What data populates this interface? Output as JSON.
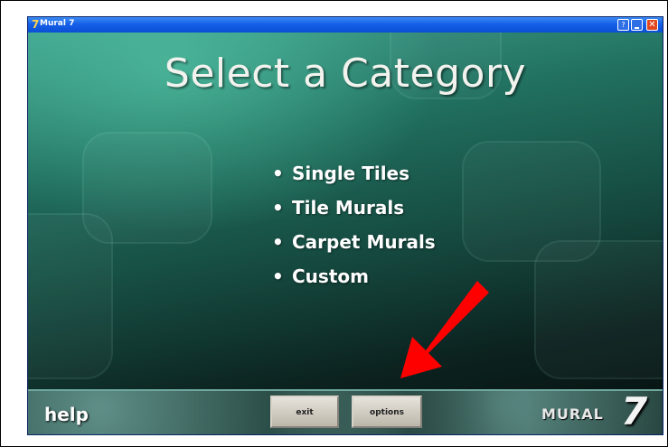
{
  "window": {
    "title": "Mural 7",
    "app_icon_glyph": "7"
  },
  "titlebar_buttons": [
    {
      "name": "help",
      "glyph": "?"
    },
    {
      "name": "minimize",
      "glyph": ""
    },
    {
      "name": "close",
      "glyph": "✕"
    }
  ],
  "main": {
    "heading": "Select a Category",
    "categories": [
      "Single Tiles",
      "Tile Murals",
      "Carpet Murals",
      "Custom"
    ]
  },
  "footer": {
    "help_label": "help",
    "exit_label": "exit",
    "options_label": "options",
    "logo_text": "MURAL",
    "logo_number": "7"
  },
  "annotation": {
    "arrow_color": "#ff0000",
    "arrow_target": "options-button"
  },
  "colors": {
    "titlebar": "#1560e8",
    "close": "#e0471f",
    "background_teal": "#21705f"
  }
}
